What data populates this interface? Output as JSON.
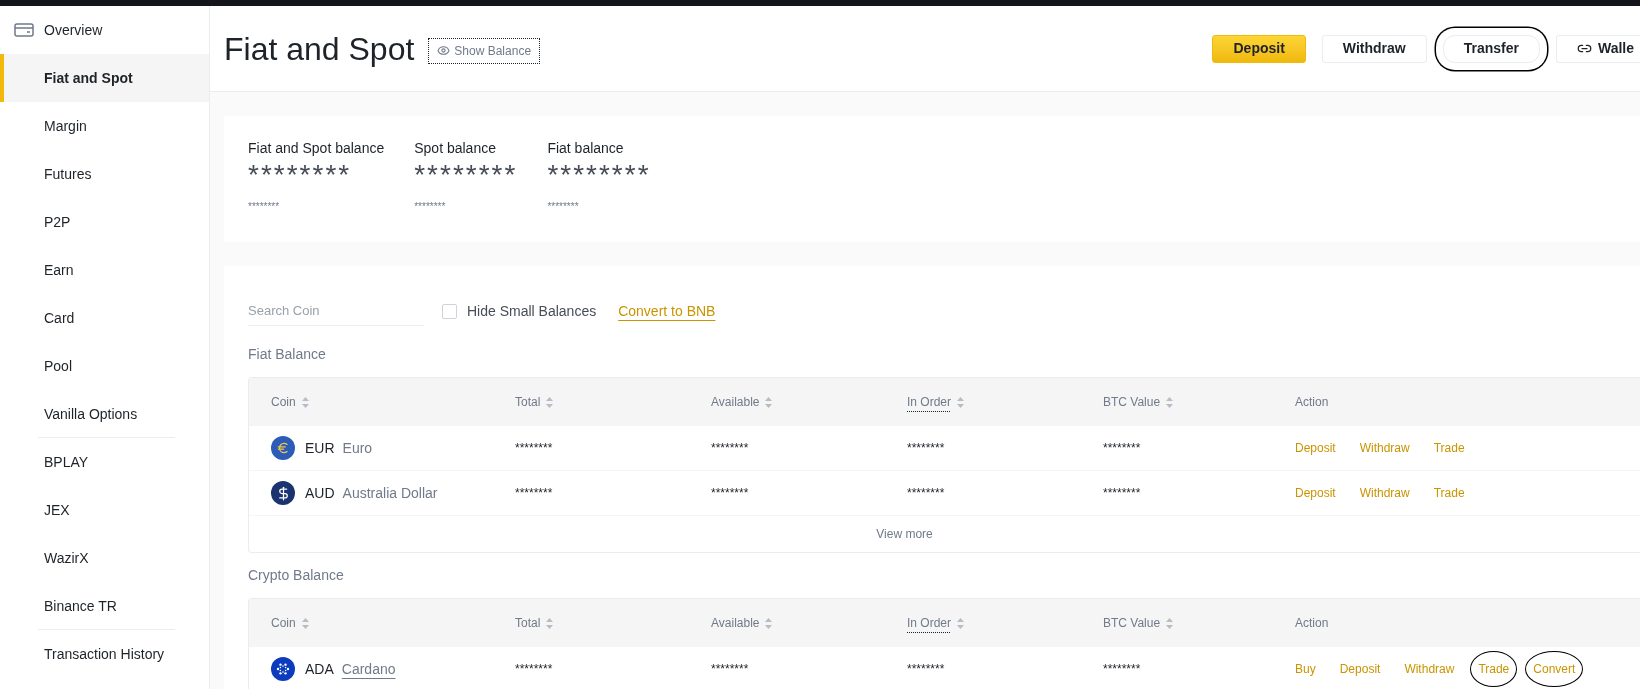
{
  "sidebar": {
    "items": [
      {
        "label": "Overview",
        "kind": "section",
        "selected": false,
        "divider_after": false
      },
      {
        "label": "Fiat and Spot",
        "kind": "item",
        "selected": true,
        "divider_after": false
      },
      {
        "label": "Margin",
        "kind": "item",
        "selected": false,
        "divider_after": false
      },
      {
        "label": "Futures",
        "kind": "item",
        "selected": false,
        "divider_after": false
      },
      {
        "label": "P2P",
        "kind": "item",
        "selected": false,
        "divider_after": false
      },
      {
        "label": "Earn",
        "kind": "item",
        "selected": false,
        "divider_after": false
      },
      {
        "label": "Card",
        "kind": "item",
        "selected": false,
        "divider_after": false
      },
      {
        "label": "Pool",
        "kind": "item",
        "selected": false,
        "divider_after": false
      },
      {
        "label": "Vanilla Options",
        "kind": "item",
        "selected": false,
        "divider_after": true
      },
      {
        "label": "BPLAY",
        "kind": "item",
        "selected": false,
        "divider_after": false
      },
      {
        "label": "JEX",
        "kind": "item",
        "selected": false,
        "divider_after": false
      },
      {
        "label": "WazirX",
        "kind": "item",
        "selected": false,
        "divider_after": false
      },
      {
        "label": "Binance TR",
        "kind": "item",
        "selected": false,
        "divider_after": true
      },
      {
        "label": "Transaction History",
        "kind": "item",
        "selected": false,
        "divider_after": false
      }
    ]
  },
  "header": {
    "title": "Fiat and Spot",
    "show_balance": "Show Balance",
    "buttons": [
      {
        "label": "Deposit",
        "kind": "primary",
        "circled": false
      },
      {
        "label": "Withdraw",
        "kind": "secondary",
        "circled": false
      },
      {
        "label": "Transfer",
        "kind": "secondary",
        "circled": true
      },
      {
        "label": "Walle",
        "kind": "link",
        "circled": false
      }
    ]
  },
  "balances": [
    {
      "label": "Fiat and Spot balance",
      "value": "********",
      "sub": "********"
    },
    {
      "label": "Spot balance",
      "value": "********",
      "sub": "********"
    },
    {
      "label": "Fiat balance",
      "value": "********",
      "sub": "********"
    }
  ],
  "toolbar": {
    "search_placeholder": "Search Coin",
    "hide_small": {
      "label": "Hide Small Balances",
      "checked": false
    },
    "convert_link": "Convert to BNB"
  },
  "sections": [
    {
      "title": "Fiat Balance",
      "columns": [
        {
          "label": "Coin",
          "sortable": true,
          "dotted": false
        },
        {
          "label": "Total",
          "sortable": true,
          "dotted": false
        },
        {
          "label": "Available",
          "sortable": true,
          "dotted": false
        },
        {
          "label": "In Order",
          "sortable": true,
          "dotted": true
        },
        {
          "label": "BTC Value",
          "sortable": true,
          "dotted": false
        },
        {
          "label": "Action",
          "sortable": false,
          "dotted": false
        }
      ],
      "rows": [
        {
          "kind": "euro",
          "code": "EUR",
          "name": "Euro",
          "name_underlined": false,
          "total": "********",
          "available": "********",
          "in_order": "********",
          "btc_value": "********",
          "actions": [
            {
              "label": "Deposit",
              "circled": false
            },
            {
              "label": "Withdraw",
              "circled": false
            },
            {
              "label": "Trade",
              "circled": false
            }
          ]
        },
        {
          "kind": "dollar",
          "code": "AUD",
          "name": "Australia Dollar",
          "name_underlined": false,
          "total": "********",
          "available": "********",
          "in_order": "********",
          "btc_value": "********",
          "actions": [
            {
              "label": "Deposit",
              "circled": false
            },
            {
              "label": "Withdraw",
              "circled": false
            },
            {
              "label": "Trade",
              "circled": false
            }
          ]
        }
      ],
      "view_more": "View more"
    },
    {
      "title": "Crypto Balance",
      "columns": [
        {
          "label": "Coin",
          "sortable": true,
          "dotted": false
        },
        {
          "label": "Total",
          "sortable": true,
          "dotted": false
        },
        {
          "label": "Available",
          "sortable": true,
          "dotted": false
        },
        {
          "label": "In Order",
          "sortable": true,
          "dotted": true
        },
        {
          "label": "BTC Value",
          "sortable": true,
          "dotted": false
        },
        {
          "label": "Action",
          "sortable": false,
          "dotted": false
        }
      ],
      "rows": [
        {
          "kind": "cardano",
          "code": "ADA",
          "name": "Cardano",
          "name_underlined": true,
          "total": "********",
          "available": "********",
          "in_order": "********",
          "btc_value": "********",
          "actions": [
            {
              "label": "Buy",
              "circled": false
            },
            {
              "label": "Deposit",
              "circled": false
            },
            {
              "label": "Withdraw",
              "circled": false
            },
            {
              "label": "Trade",
              "circled": true
            },
            {
              "label": "Convert",
              "circled": true
            }
          ]
        }
      ]
    }
  ]
}
